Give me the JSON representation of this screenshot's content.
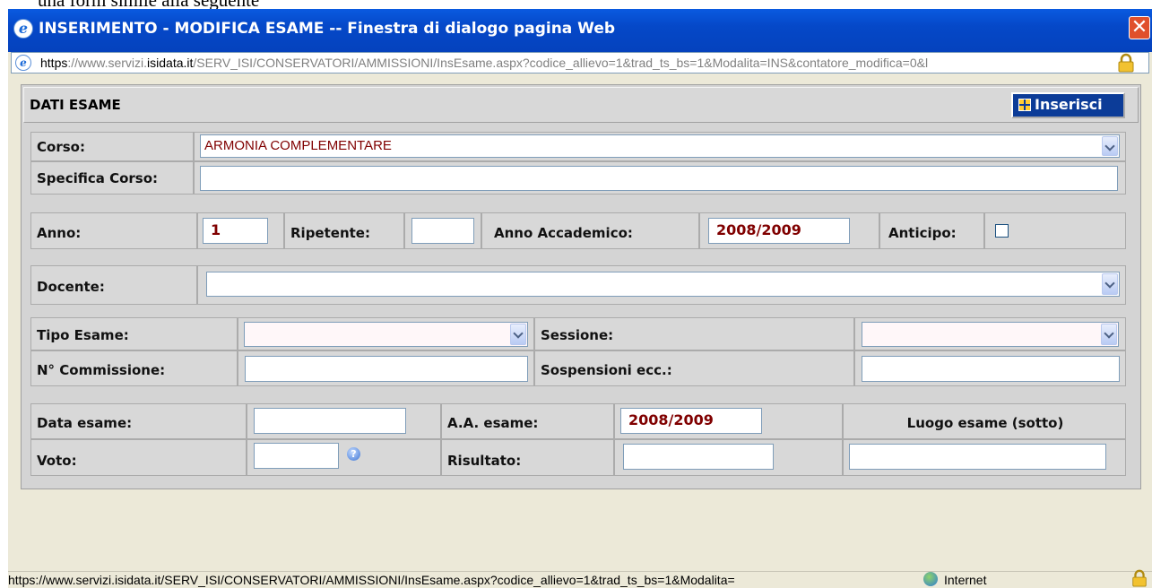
{
  "background_fragment": "una form simile alla seguente",
  "window": {
    "title": "INSERIMENTO - MODIFICA ESAME -- Finestra di dialogo pagina Web",
    "close_label": "✕",
    "url_prefix": "https",
    "url_gray1": "://www.servizi.",
    "url_domain": "isidata.it",
    "url_rest": "/SERV_ISI/CONSERVATORI/AMMISSIONI/InsEsame.aspx?codice_allievo=1&trad_ts_bs=1&Modalita=INS&contatore_modifica=0&l"
  },
  "form": {
    "header_title": "DATI ESAME",
    "insert_label": "Inserisci",
    "corso": {
      "label": "Corso:",
      "value": "ARMONIA COMPLEMENTARE"
    },
    "specifica_corso": {
      "label": "Specifica Corso:",
      "value": ""
    },
    "anno": {
      "label": "Anno:",
      "value": "1"
    },
    "ripetente": {
      "label": "Ripetente:",
      "value": ""
    },
    "anno_accademico": {
      "label": "Anno Accademico:",
      "value": "2008/2009"
    },
    "anticipo": {
      "label": "Anticipo:",
      "checked": false
    },
    "docente": {
      "label": "Docente:",
      "value": ""
    },
    "tipo_esame": {
      "label": "Tipo Esame:",
      "value": ""
    },
    "sessione": {
      "label": "Sessione:",
      "value": ""
    },
    "n_commissione": {
      "label": "N° Commissione:",
      "value": ""
    },
    "sospensioni": {
      "label": "Sospensioni ecc.:",
      "value": ""
    },
    "data_esame": {
      "label": "Data esame:",
      "value": ""
    },
    "aa_esame": {
      "label": "A.A. esame:",
      "value": "2008/2009"
    },
    "luogo_esame": {
      "label": "Luogo esame (sotto)"
    },
    "voto": {
      "label": "Voto:",
      "value": "",
      "help_glyph": "?"
    },
    "risultato": {
      "label": "Risultato:",
      "value": ""
    },
    "luogo_field": {
      "value": ""
    }
  },
  "statusbar": {
    "url": "https://www.servizi.isidata.it/SERV_ISI/CONSERVATORI/AMMISSIONI/InsEsame.aspx?codice_allievo=1&trad_ts_bs=1&Modalita=",
    "zone": "Internet"
  },
  "colors": {
    "titlebar": "#0548c8",
    "field_text": "#800000",
    "button": "#0c3c98"
  }
}
